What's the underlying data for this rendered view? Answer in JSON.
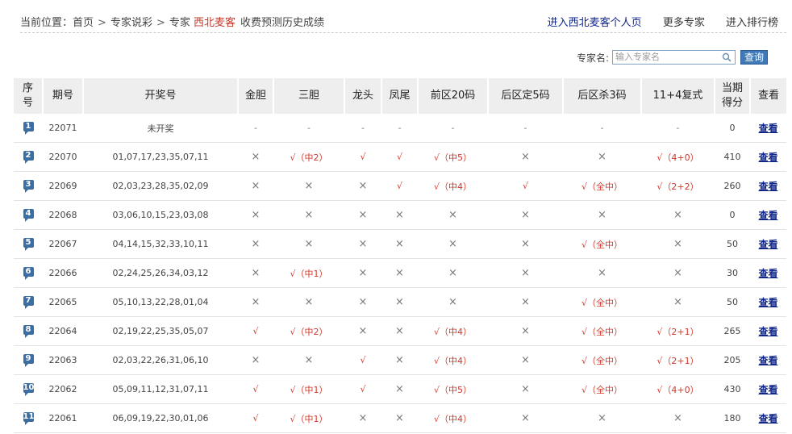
{
  "breadcrumb": {
    "prefix": "当前位置：",
    "items": [
      "首页",
      "专家说彩",
      "专家"
    ],
    "separator": ">",
    "expert_name": "西北麦客",
    "suffix": "收费预测历史成绩"
  },
  "top_links": {
    "personal_page": "进入西北麦客个人页",
    "more_experts": "更多专家",
    "ranking": "进入排行榜"
  },
  "search": {
    "label": "专家名:",
    "placeholder": "输入专家名",
    "button": "查询"
  },
  "colors": {
    "hit": "#d0392b",
    "link": "#10268a",
    "badge": "#3a6ea5",
    "header_bg": "#eeeeee"
  },
  "table": {
    "headers": [
      "序号",
      "期号",
      "开奖号",
      "金胆",
      "三胆",
      "龙头",
      "凤尾",
      "前区20码",
      "后区定5码",
      "后区杀3码",
      "11+4复式",
      "当期得分",
      "查看"
    ],
    "rows": [
      {
        "no": "1",
        "issue": "22071",
        "draw": "未开奖",
        "c": [
          "-",
          "-",
          "-",
          "-",
          "-",
          "-",
          "-",
          "-"
        ],
        "score": "0",
        "view": "查看"
      },
      {
        "no": "2",
        "issue": "22070",
        "draw": "01,07,17,23,35,07,11",
        "c": [
          "×",
          "√（中2）",
          "√",
          "√",
          "√（中5）",
          "×",
          "×",
          "√（4+0）"
        ],
        "score": "410",
        "view": "查看"
      },
      {
        "no": "3",
        "issue": "22069",
        "draw": "02,03,23,28,35,02,09",
        "c": [
          "×",
          "×",
          "×",
          "√",
          "√（中4）",
          "√",
          "√（全中）",
          "√（2+2）"
        ],
        "score": "260",
        "view": "查看"
      },
      {
        "no": "4",
        "issue": "22068",
        "draw": "03,06,10,15,23,03,08",
        "c": [
          "×",
          "×",
          "×",
          "×",
          "×",
          "×",
          "×",
          "×"
        ],
        "score": "0",
        "view": "查看"
      },
      {
        "no": "5",
        "issue": "22067",
        "draw": "04,14,15,32,33,10,11",
        "c": [
          "×",
          "×",
          "×",
          "×",
          "×",
          "×",
          "√（全中）",
          "×"
        ],
        "score": "50",
        "view": "查看"
      },
      {
        "no": "6",
        "issue": "22066",
        "draw": "02,24,25,26,34,03,12",
        "c": [
          "×",
          "√（中1）",
          "×",
          "×",
          "×",
          "×",
          "×",
          "×"
        ],
        "score": "30",
        "view": "查看"
      },
      {
        "no": "7",
        "issue": "22065",
        "draw": "05,10,13,22,28,01,04",
        "c": [
          "×",
          "×",
          "×",
          "×",
          "×",
          "×",
          "√（全中）",
          "×"
        ],
        "score": "50",
        "view": "查看"
      },
      {
        "no": "8",
        "issue": "22064",
        "draw": "02,19,22,25,35,05,07",
        "c": [
          "√",
          "√（中2）",
          "×",
          "×",
          "√（中4）",
          "×",
          "√（全中）",
          "√（2+1）"
        ],
        "score": "265",
        "view": "查看"
      },
      {
        "no": "9",
        "issue": "22063",
        "draw": "02,03,22,26,31,06,10",
        "c": [
          "×",
          "×",
          "√",
          "×",
          "√（中4）",
          "×",
          "√（全中）",
          "√（2+1）"
        ],
        "score": "205",
        "view": "查看"
      },
      {
        "no": "10",
        "issue": "22062",
        "draw": "05,09,11,12,31,07,11",
        "c": [
          "√",
          "√（中1）",
          "√",
          "×",
          "√（中5）",
          "×",
          "√（全中）",
          "√（4+0）"
        ],
        "score": "430",
        "view": "查看"
      },
      {
        "no": "11",
        "issue": "22061",
        "draw": "06,09,19,22,30,01,06",
        "c": [
          "√",
          "√（中1）",
          "×",
          "×",
          "√（中4）",
          "×",
          "×",
          "×"
        ],
        "score": "180",
        "view": "查看"
      }
    ]
  }
}
